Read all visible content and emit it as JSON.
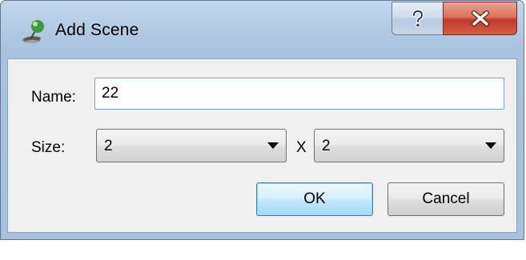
{
  "window": {
    "title": "Add Scene",
    "app_icon": "globe-pin-icon",
    "help_icon": "question-mark-icon",
    "close_icon": "close-x-icon",
    "close_color": "#c0392b"
  },
  "form": {
    "name_label": "Name:",
    "name_value": "22",
    "size_label": "Size:",
    "size_width_value": "2",
    "size_separator": "X",
    "size_height_value": "2"
  },
  "buttons": {
    "ok_label": "OK",
    "cancel_label": "Cancel"
  }
}
